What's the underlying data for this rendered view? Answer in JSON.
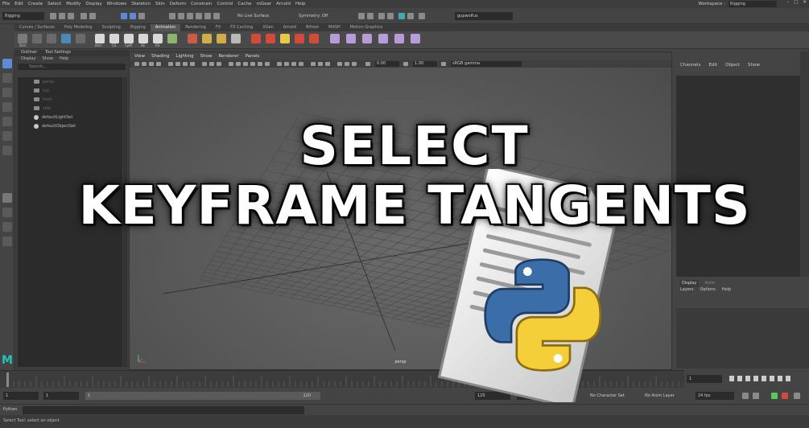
{
  "menubar": {
    "items": [
      "File",
      "Edit",
      "Create",
      "Select",
      "Modify",
      "Display",
      "Windows",
      "Skeleton",
      "Skin",
      "Deform",
      "Constrain",
      "Control",
      "Cache",
      "mGear",
      "Arnold",
      "Help"
    ],
    "workspace_label": "Workspace :",
    "workspace_value": "Rigging"
  },
  "statusline": {
    "mode": "Rigging",
    "live_surface": "No Live Surface",
    "symmetry": "Symmetry: Off",
    "user": "gupwolfus"
  },
  "shelf": {
    "tabs": [
      "Curves / Surfaces",
      "Poly Modeling",
      "Sculpting",
      "Rigging",
      "Animation",
      "Rendering",
      "FX",
      "FX Caching",
      "XGen",
      "Arnold",
      "Bifrost",
      "MASH",
      "Motion Graphics"
    ],
    "active_tab": "Animation",
    "icon_labels": [
      "Skin",
      "",
      "",
      "",
      "",
      "",
      "Dsrt",
      "CS",
      "CpM",
      "SE",
      "RS"
    ]
  },
  "outliner": {
    "tabs": [
      "Outliner",
      "Tool Settings"
    ],
    "menu": [
      "Display",
      "Show",
      "Help"
    ],
    "search_placeholder": "Search...",
    "items": [
      {
        "label": "persp",
        "dim": true
      },
      {
        "label": "top",
        "dim": true
      },
      {
        "label": "front",
        "dim": true
      },
      {
        "label": "side",
        "dim": true
      },
      {
        "label": "defaultLightSet",
        "dim": false
      },
      {
        "label": "defaultObjectSet",
        "dim": false
      }
    ]
  },
  "viewport": {
    "menu": [
      "View",
      "Shading",
      "Lighting",
      "Show",
      "Renderer",
      "Panels"
    ],
    "field_a": "0.00",
    "field_b": "1.00",
    "colorspace": "sRGB gamma",
    "camera": "persp"
  },
  "channelbox": {
    "menu": [
      "Channels",
      "Edit",
      "Object",
      "Show"
    ]
  },
  "layers": {
    "tabs": [
      "Display",
      "Anim"
    ],
    "active_tab": "Display",
    "menu": [
      "Layers",
      "Options",
      "Help"
    ]
  },
  "timeline": {
    "current_frame": "1"
  },
  "rangebar": {
    "start": "1",
    "anim_start": "1",
    "range_start_handle": "1",
    "range_end_handle": "120",
    "range_end": "120",
    "anim_end": "200",
    "character_set": "No Character Set",
    "anim_layer": "No Anim Layer",
    "fps": "24 fps"
  },
  "cmdline": {
    "label": "Python"
  },
  "helpline": {
    "text": "Select Tool: select an object"
  },
  "overlay": {
    "line1": "SELECT",
    "line2": "KEYFRAME TANGENTS"
  },
  "logo": {
    "text": "M"
  },
  "colors": {
    "python_blue": "#3b6ea8",
    "python_yellow": "#f4cf3a",
    "shelf_red": "#d14a3a",
    "shelf_yellow": "#e8c84a",
    "shelf_teal": "#3fa9b4",
    "maya_teal": "#28c3b8"
  }
}
